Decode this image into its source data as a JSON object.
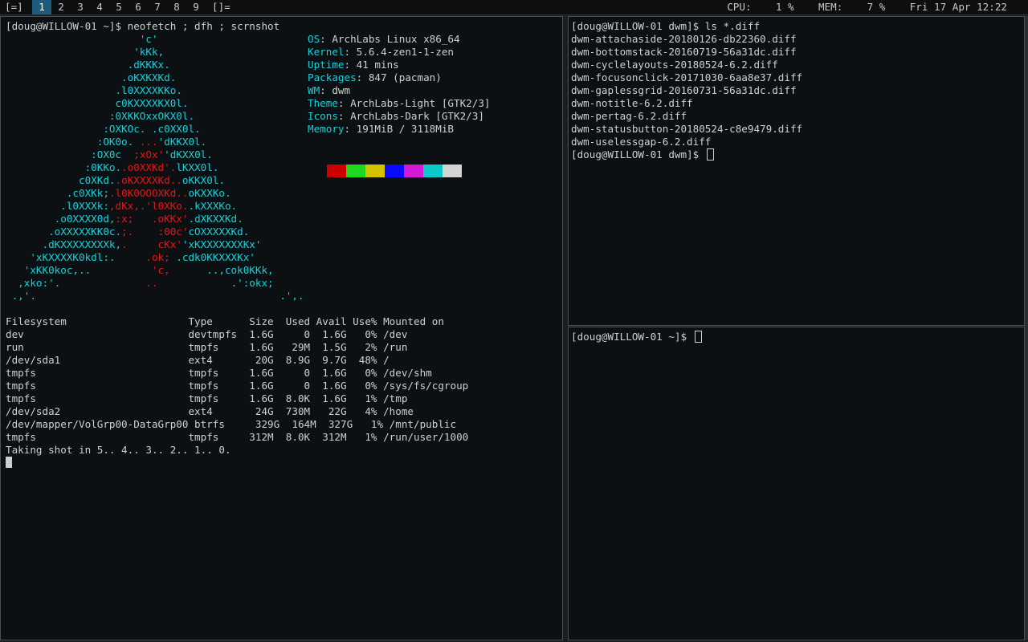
{
  "bar": {
    "layout_symbol": "[=]",
    "tags": [
      "1",
      "2",
      "3",
      "4",
      "5",
      "6",
      "7",
      "8",
      "9"
    ],
    "selected_tag": "1",
    "layout_symbol_2": "[]=",
    "status": "CPU:    1 %    MEM:    7 %    Fri 17 Apr 12:22"
  },
  "term1": {
    "prompt_cmd": "[doug@WILLOW-01 ~]$ neofetch ; dfh ; scrnshot",
    "logo": [
      [
        [
          "c",
          "                      'c'"
        ]
      ],
      [
        [
          "c",
          "                     'kKk,"
        ]
      ],
      [
        [
          "c",
          "                    .dKKKx."
        ]
      ],
      [
        [
          "c",
          "                   .oKXKXKd."
        ]
      ],
      [
        [
          "c",
          "                  .l0XXXXKKo."
        ]
      ],
      [
        [
          "c",
          "                  c0KXXXXKX0l."
        ]
      ],
      [
        [
          "c",
          "                 :0XKKOxxOKX0l."
        ]
      ],
      [
        [
          "c",
          "                :OXKOc. .c0XX0l."
        ]
      ],
      [
        [
          "c",
          "               :OK0o. "
        ],
        [
          "r",
          "..."
        ],
        [
          "c",
          "'dKKX0l."
        ]
      ],
      [
        [
          "c",
          "              :OX0c  "
        ],
        [
          "r",
          ";xOx'"
        ],
        [
          "c",
          "'dKXX0l."
        ]
      ],
      [
        [
          "c",
          "             :0KKo."
        ],
        [
          "r",
          ".o0XXKd'."
        ],
        [
          "c",
          "lKXX0l."
        ]
      ],
      [
        [
          "c",
          "            c0XKd."
        ],
        [
          "r",
          ".oKXXXXKd.."
        ],
        [
          "c",
          "oKKX0l."
        ]
      ],
      [
        [
          "c",
          "          .c0XKk;"
        ],
        [
          "r",
          ".l0K0OOOXKd.."
        ],
        [
          "c",
          "oKXXKo."
        ]
      ],
      [
        [
          "c",
          "         .l0XXXk:"
        ],
        [
          "r",
          ",dKx,.'l0XKo."
        ],
        [
          "c",
          ".kXXXKo."
        ]
      ],
      [
        [
          "c",
          "        .o0XXXX0d,"
        ],
        [
          "r",
          ":x;   .oKKx'"
        ],
        [
          "c",
          ".dXKXXKd."
        ]
      ],
      [
        [
          "c",
          "       .oXXXXXKK0c."
        ],
        [
          "r",
          ";.    :00c'"
        ],
        [
          "c",
          "cOXXXXXKd."
        ]
      ],
      [
        [
          "c",
          "      .dKXXXXXXXXk,"
        ],
        [
          "r",
          ".     cKx'"
        ],
        [
          "c",
          "'xKXXXXXXXKx'"
        ]
      ],
      [
        [
          "c",
          "    'xKXXXXK0kdl:."
        ],
        [
          "r",
          "     .ok; "
        ],
        [
          "c",
          ".cdk0KKXXXKx'"
        ]
      ],
      [
        [
          "c",
          "   'xKK0koc,.."
        ],
        [
          "r",
          "          'c,  "
        ],
        [
          "c",
          "    ..,cok0KKk,"
        ]
      ],
      [
        [
          "c",
          "  ,xko:'."
        ],
        [
          "r",
          "              .."
        ],
        [
          "c",
          "            .':okx;"
        ]
      ],
      [
        [
          "c",
          " .,'."
        ],
        [
          "c",
          "                                        .',."
        ]
      ]
    ],
    "info": [
      {
        "key": "OS",
        "value": " ArchLabs Linux x86_64"
      },
      {
        "key": "Kernel",
        "value": " 5.6.4-zen1-1-zen"
      },
      {
        "key": "Uptime",
        "value": " 41 mins"
      },
      {
        "key": "Packages",
        "value": " 847 (pacman)"
      },
      {
        "key": "WM",
        "value": " dwm"
      },
      {
        "key": "Theme",
        "value": " ArchLabs-Light [GTK2/3]"
      },
      {
        "key": "Icons",
        "value": " ArchLabs-Dark [GTK2/3]"
      },
      {
        "key": "Memory",
        "value": " 191MiB / 3118MiB"
      }
    ],
    "swatches": [
      "#cc0000",
      "#1ed81e",
      "#d4c400",
      "#0a0aff",
      "#d41ad4",
      "#0cc8c8",
      "#d4d4d4"
    ],
    "df": [
      "Filesystem                    Type      Size  Used Avail Use% Mounted on",
      "dev                           devtmpfs  1.6G     0  1.6G   0% /dev",
      "run                           tmpfs     1.6G   29M  1.5G   2% /run",
      "/dev/sda1                     ext4       20G  8.9G  9.7G  48% /",
      "tmpfs                         tmpfs     1.6G     0  1.6G   0% /dev/shm",
      "tmpfs                         tmpfs     1.6G     0  1.6G   0% /sys/fs/cgroup",
      "tmpfs                         tmpfs     1.6G  8.0K  1.6G   1% /tmp",
      "/dev/sda2                     ext4       24G  730M   22G   4% /home",
      "/dev/mapper/VolGrp00-DataGrp00 btrfs     329G  164M  327G   1% /mnt/public",
      "tmpfs                         tmpfs     312M  8.0K  312M   1% /run/user/1000"
    ],
    "shot": "Taking shot in 5.. 4.. 3.. 2.. 1.. 0."
  },
  "term2": {
    "lines": [
      "[doug@WILLOW-01 dwm]$ ls *.diff",
      "dwm-attachaside-20180126-db22360.diff",
      "dwm-bottomstack-20160719-56a31dc.diff",
      "dwm-cyclelayouts-20180524-6.2.diff",
      "dwm-focusonclick-20171030-6aa8e37.diff",
      "dwm-gaplessgrid-20160731-56a31dc.diff",
      "dwm-notitle-6.2.diff",
      "dwm-pertag-6.2.diff",
      "dwm-statusbutton-20180524-c8e9479.diff",
      "dwm-uselessgap-6.2.diff"
    ],
    "prompt": "[doug@WILLOW-01 dwm]$ "
  },
  "term3": {
    "prompt": "[doug@WILLOW-01 ~]$ "
  }
}
